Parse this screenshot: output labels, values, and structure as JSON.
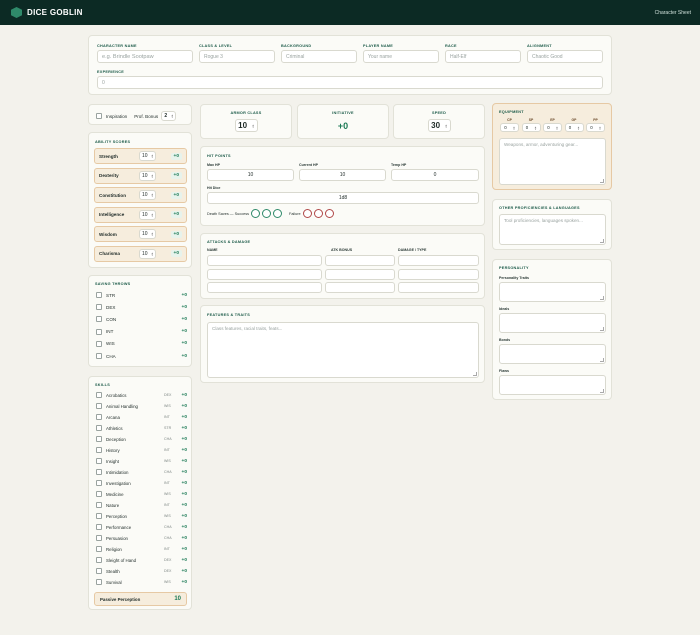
{
  "app": {
    "title": "DICE GOBLIN",
    "nav_label": "Character Sheet"
  },
  "character": {
    "name_label": "CHARACTER NAME",
    "name_placeholder": "e.g. Brindle Sootpaw",
    "class_label": "CLASS & LEVEL",
    "class_placeholder": "Rogue 3",
    "background_label": "BACKGROUND",
    "background_placeholder": "Criminal",
    "player_label": "PLAYER NAME",
    "player_placeholder": "Your name",
    "race_label": "RACE",
    "race_placeholder": "Half-Elf",
    "alignment_label": "ALIGNMENT",
    "alignment_placeholder": "Chaotic Good",
    "experience_label": "EXPERIENCE",
    "experience_placeholder": "0"
  },
  "inspiration": {
    "label": "Inspiration",
    "prof_label": "Prof. Bonus",
    "prof_value": "2"
  },
  "ability_scores": {
    "title": "ABILITY SCORES",
    "items": [
      {
        "name": "Strength",
        "score": "10",
        "mod": "+0"
      },
      {
        "name": "Dexterity",
        "score": "10",
        "mod": "+0"
      },
      {
        "name": "Constitution",
        "score": "10",
        "mod": "+0"
      },
      {
        "name": "Intelligence",
        "score": "10",
        "mod": "+0"
      },
      {
        "name": "Wisdom",
        "score": "10",
        "mod": "+0"
      },
      {
        "name": "Charisma",
        "score": "10",
        "mod": "+0"
      }
    ]
  },
  "saving_throws": {
    "title": "SAVING THROWS",
    "items": [
      {
        "name": "STR",
        "mod": "+0"
      },
      {
        "name": "DEX",
        "mod": "+0"
      },
      {
        "name": "CON",
        "mod": "+0"
      },
      {
        "name": "INT",
        "mod": "+0"
      },
      {
        "name": "WIS",
        "mod": "+0"
      },
      {
        "name": "CHA",
        "mod": "+0"
      }
    ]
  },
  "skills": {
    "title": "SKILLS",
    "items": [
      {
        "name": "Acrobatics",
        "attr": "DEX",
        "mod": "+0"
      },
      {
        "name": "Animal Handling",
        "attr": "WIS",
        "mod": "+0"
      },
      {
        "name": "Arcana",
        "attr": "INT",
        "mod": "+0"
      },
      {
        "name": "Athletics",
        "attr": "STR",
        "mod": "+0"
      },
      {
        "name": "Deception",
        "attr": "CHA",
        "mod": "+0"
      },
      {
        "name": "History",
        "attr": "INT",
        "mod": "+0"
      },
      {
        "name": "Insight",
        "attr": "WIS",
        "mod": "+0"
      },
      {
        "name": "Intimidation",
        "attr": "CHA",
        "mod": "+0"
      },
      {
        "name": "Investigation",
        "attr": "INT",
        "mod": "+0"
      },
      {
        "name": "Medicine",
        "attr": "WIS",
        "mod": "+0"
      },
      {
        "name": "Nature",
        "attr": "INT",
        "mod": "+0"
      },
      {
        "name": "Perception",
        "attr": "WIS",
        "mod": "+0"
      },
      {
        "name": "Performance",
        "attr": "CHA",
        "mod": "+0"
      },
      {
        "name": "Persuasion",
        "attr": "CHA",
        "mod": "+0"
      },
      {
        "name": "Religion",
        "attr": "INT",
        "mod": "+0"
      },
      {
        "name": "Sleight of Hand",
        "attr": "DEX",
        "mod": "+0"
      },
      {
        "name": "Stealth",
        "attr": "DEX",
        "mod": "+0"
      },
      {
        "name": "Survival",
        "attr": "WIS",
        "mod": "+0"
      }
    ],
    "passive_label": "Passive Perception",
    "passive_value": "10"
  },
  "combat": {
    "ac_label": "ARMOR CLASS",
    "ac_value": "10",
    "init_label": "INITIATIVE",
    "init_value": "+0",
    "speed_label": "SPEED",
    "speed_value": "30"
  },
  "hp": {
    "title": "HIT POINTS",
    "max_label": "Max HP",
    "max_value": "10",
    "current_label": "Current HP",
    "current_value": "10",
    "temp_label": "Temp HP",
    "temp_value": "0",
    "dice_label": "Hit Dice",
    "dice_value": "1d8",
    "death_success_label": "Death Saves — Success",
    "death_fail_label": "Failure"
  },
  "attacks": {
    "title": "ATTACKS & DAMAGE",
    "col_name": "NAME",
    "col_bonus": "ATK BONUS",
    "col_damage": "DAMAGE / TYPE"
  },
  "features": {
    "title": "FEATURES & TRAITS",
    "placeholder": "Class features, racial traits, feats..."
  },
  "equipment": {
    "title": "EQUIPMENT",
    "coins": [
      {
        "label": "CP",
        "value": "0"
      },
      {
        "label": "SP",
        "value": "0"
      },
      {
        "label": "EP",
        "value": "0"
      },
      {
        "label": "GP",
        "value": "0"
      },
      {
        "label": "PP",
        "value": "0"
      }
    ],
    "placeholder": "Weapons, armor, adventuring gear..."
  },
  "proficiencies": {
    "title": "OTHER PROFICIENCIES & LANGUAGES",
    "placeholder": "Tool proficiencies, languages spoken..."
  },
  "personality": {
    "title": "PERSONALITY",
    "traits_label": "Personality Traits",
    "ideals_label": "Ideals",
    "bonds_label": "Bonds",
    "flaws_label": "Flaws"
  }
}
